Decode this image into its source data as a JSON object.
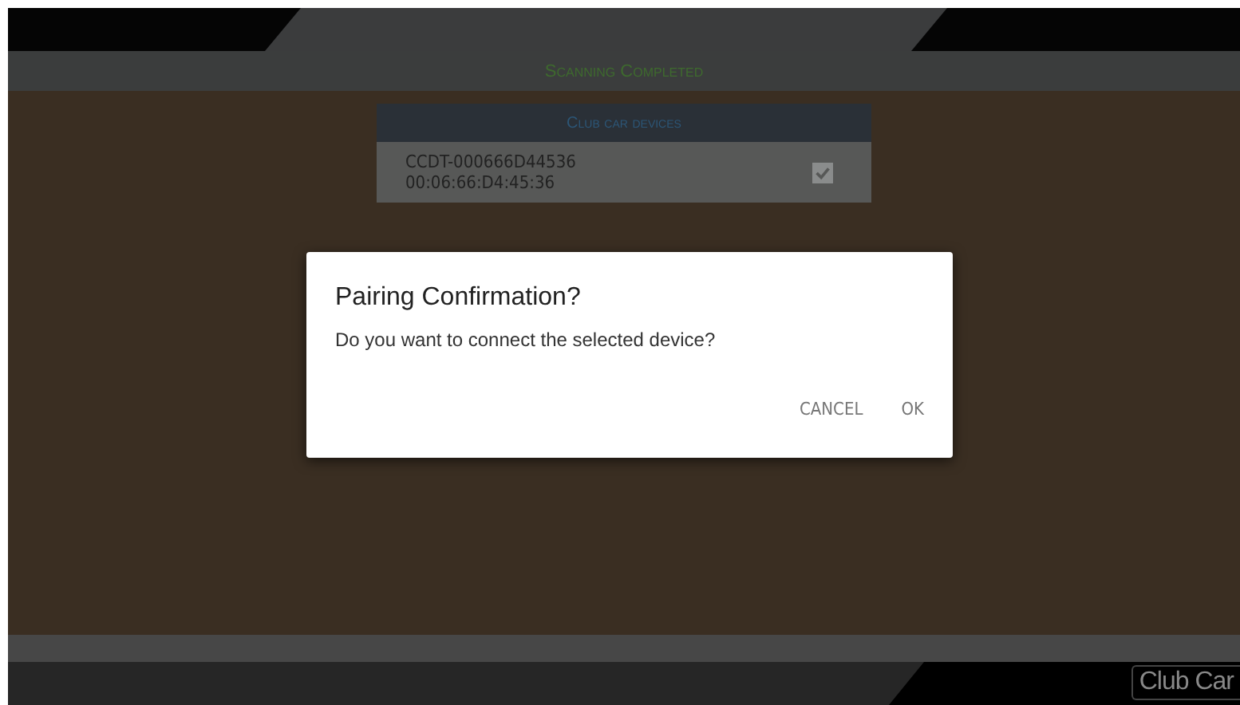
{
  "header": {
    "title": "Scanning Completed"
  },
  "device_list": {
    "title": "Club car devices",
    "devices": [
      {
        "name": "CCDT-000666D44536",
        "address": "00:06:66:D4:45:36",
        "checked": true
      }
    ]
  },
  "dialog": {
    "title": "Pairing Confirmation?",
    "message": "Do you want to connect the selected device?",
    "buttons": [
      "CANCEL",
      "OK"
    ]
  },
  "footer": {
    "logo": "Club Car"
  }
}
